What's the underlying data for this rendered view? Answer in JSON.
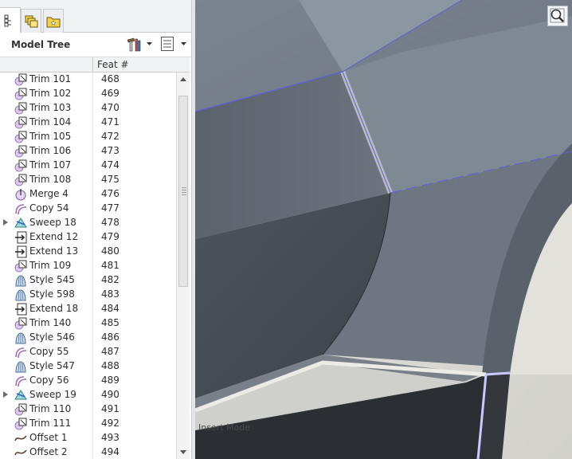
{
  "model_tree": {
    "title": "Model Tree",
    "column_header": "Feat #",
    "tabs": [
      {
        "name": "model-tree"
      },
      {
        "name": "layers"
      },
      {
        "name": "favorites"
      }
    ],
    "rows": [
      {
        "label": "Trim 101",
        "feat": "468",
        "icon": "trim-icon",
        "expander": false
      },
      {
        "label": "Trim 102",
        "feat": "469",
        "icon": "trim-icon",
        "expander": false
      },
      {
        "label": "Trim 103",
        "feat": "470",
        "icon": "trim-icon",
        "expander": false
      },
      {
        "label": "Trim 104",
        "feat": "471",
        "icon": "trim-icon",
        "expander": false
      },
      {
        "label": "Trim 105",
        "feat": "472",
        "icon": "trim-icon",
        "expander": false
      },
      {
        "label": "Trim 106",
        "feat": "473",
        "icon": "trim-icon",
        "expander": false
      },
      {
        "label": "Trim 107",
        "feat": "474",
        "icon": "trim-icon",
        "expander": false
      },
      {
        "label": "Trim 108",
        "feat": "475",
        "icon": "trim-icon",
        "expander": false
      },
      {
        "label": "Merge 4",
        "feat": "476",
        "icon": "merge-icon",
        "expander": false
      },
      {
        "label": "Copy 54",
        "feat": "477",
        "icon": "copy-icon",
        "expander": false
      },
      {
        "label": "Sweep 18",
        "feat": "478",
        "icon": "sweep-icon",
        "expander": true
      },
      {
        "label": "Extend 12",
        "feat": "479",
        "icon": "extend-icon",
        "expander": false
      },
      {
        "label": "Extend 13",
        "feat": "480",
        "icon": "extend-icon",
        "expander": false
      },
      {
        "label": "Trim 109",
        "feat": "481",
        "icon": "trim-icon",
        "expander": false
      },
      {
        "label": "Style 545",
        "feat": "482",
        "icon": "style-icon",
        "expander": false
      },
      {
        "label": "Style 598",
        "feat": "483",
        "icon": "style-icon",
        "expander": false
      },
      {
        "label": "Extend 18",
        "feat": "484",
        "icon": "extend-icon",
        "expander": false
      },
      {
        "label": "Trim 140",
        "feat": "485",
        "icon": "trim-icon",
        "expander": false
      },
      {
        "label": "Style 546",
        "feat": "486",
        "icon": "style-icon",
        "expander": false
      },
      {
        "label": "Copy 55",
        "feat": "487",
        "icon": "copy-icon",
        "expander": false
      },
      {
        "label": "Style 547",
        "feat": "488",
        "icon": "style-icon",
        "expander": false
      },
      {
        "label": "Copy 56",
        "feat": "489",
        "icon": "copy-icon",
        "expander": false
      },
      {
        "label": "Sweep 19",
        "feat": "490",
        "icon": "sweep-icon",
        "expander": true
      },
      {
        "label": "Trim 110",
        "feat": "491",
        "icon": "trim-icon",
        "expander": false
      },
      {
        "label": "Trim 111",
        "feat": "492",
        "icon": "trim-icon",
        "expander": false
      },
      {
        "label": "Offset 1",
        "feat": "493",
        "icon": "offset-icon",
        "expander": false
      },
      {
        "label": "Offset 2",
        "feat": "494",
        "icon": "offset-icon",
        "expander": false
      }
    ]
  },
  "viewport": {
    "mode_text": "Insert Mode",
    "tool": "zoom-icon"
  }
}
